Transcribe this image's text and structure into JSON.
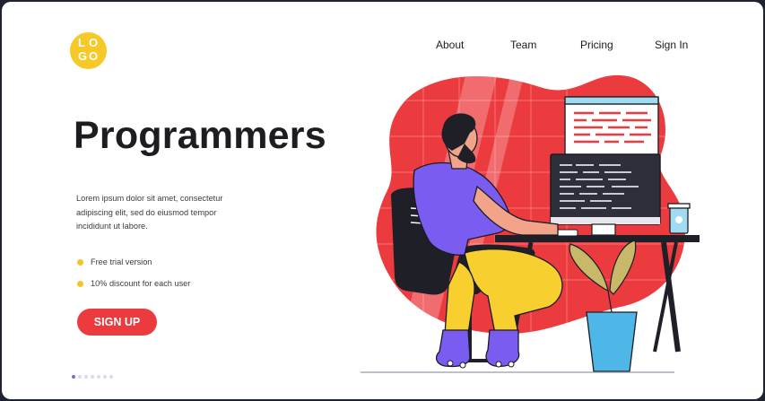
{
  "logo": {
    "letters": [
      "L",
      "O",
      "G",
      "O"
    ]
  },
  "nav": {
    "items": [
      {
        "label": "About"
      },
      {
        "label": "Team"
      },
      {
        "label": "Pricing"
      },
      {
        "label": "Sign In"
      }
    ]
  },
  "hero": {
    "title": "Programmers",
    "description_lines": [
      "Lorem ipsum dolor sit amet, consectetur",
      "adipiscing elit, sed do eiusmod tempor",
      "incididunt ut labore."
    ],
    "bullets": [
      {
        "text": "Free trial version"
      },
      {
        "text": "10% discount for each user"
      }
    ],
    "cta_label": "SIGN UP"
  },
  "pagination": {
    "total": 7,
    "active_index": 0
  },
  "colors": {
    "accent_red": "#ec3b3e",
    "logo_yellow": "#f6c928",
    "bullet_yellow": "#f2c427",
    "pager_active": "#6d6fd9",
    "pager_inactive": "#d8d9f0",
    "background_dark": "#1f2230"
  },
  "illustration": {
    "subject": "programmer at desk",
    "icons": [
      "person-icon",
      "monitor-icon",
      "chair-icon",
      "desk-icon",
      "cup-icon",
      "plant-icon",
      "code-window-icon"
    ]
  }
}
